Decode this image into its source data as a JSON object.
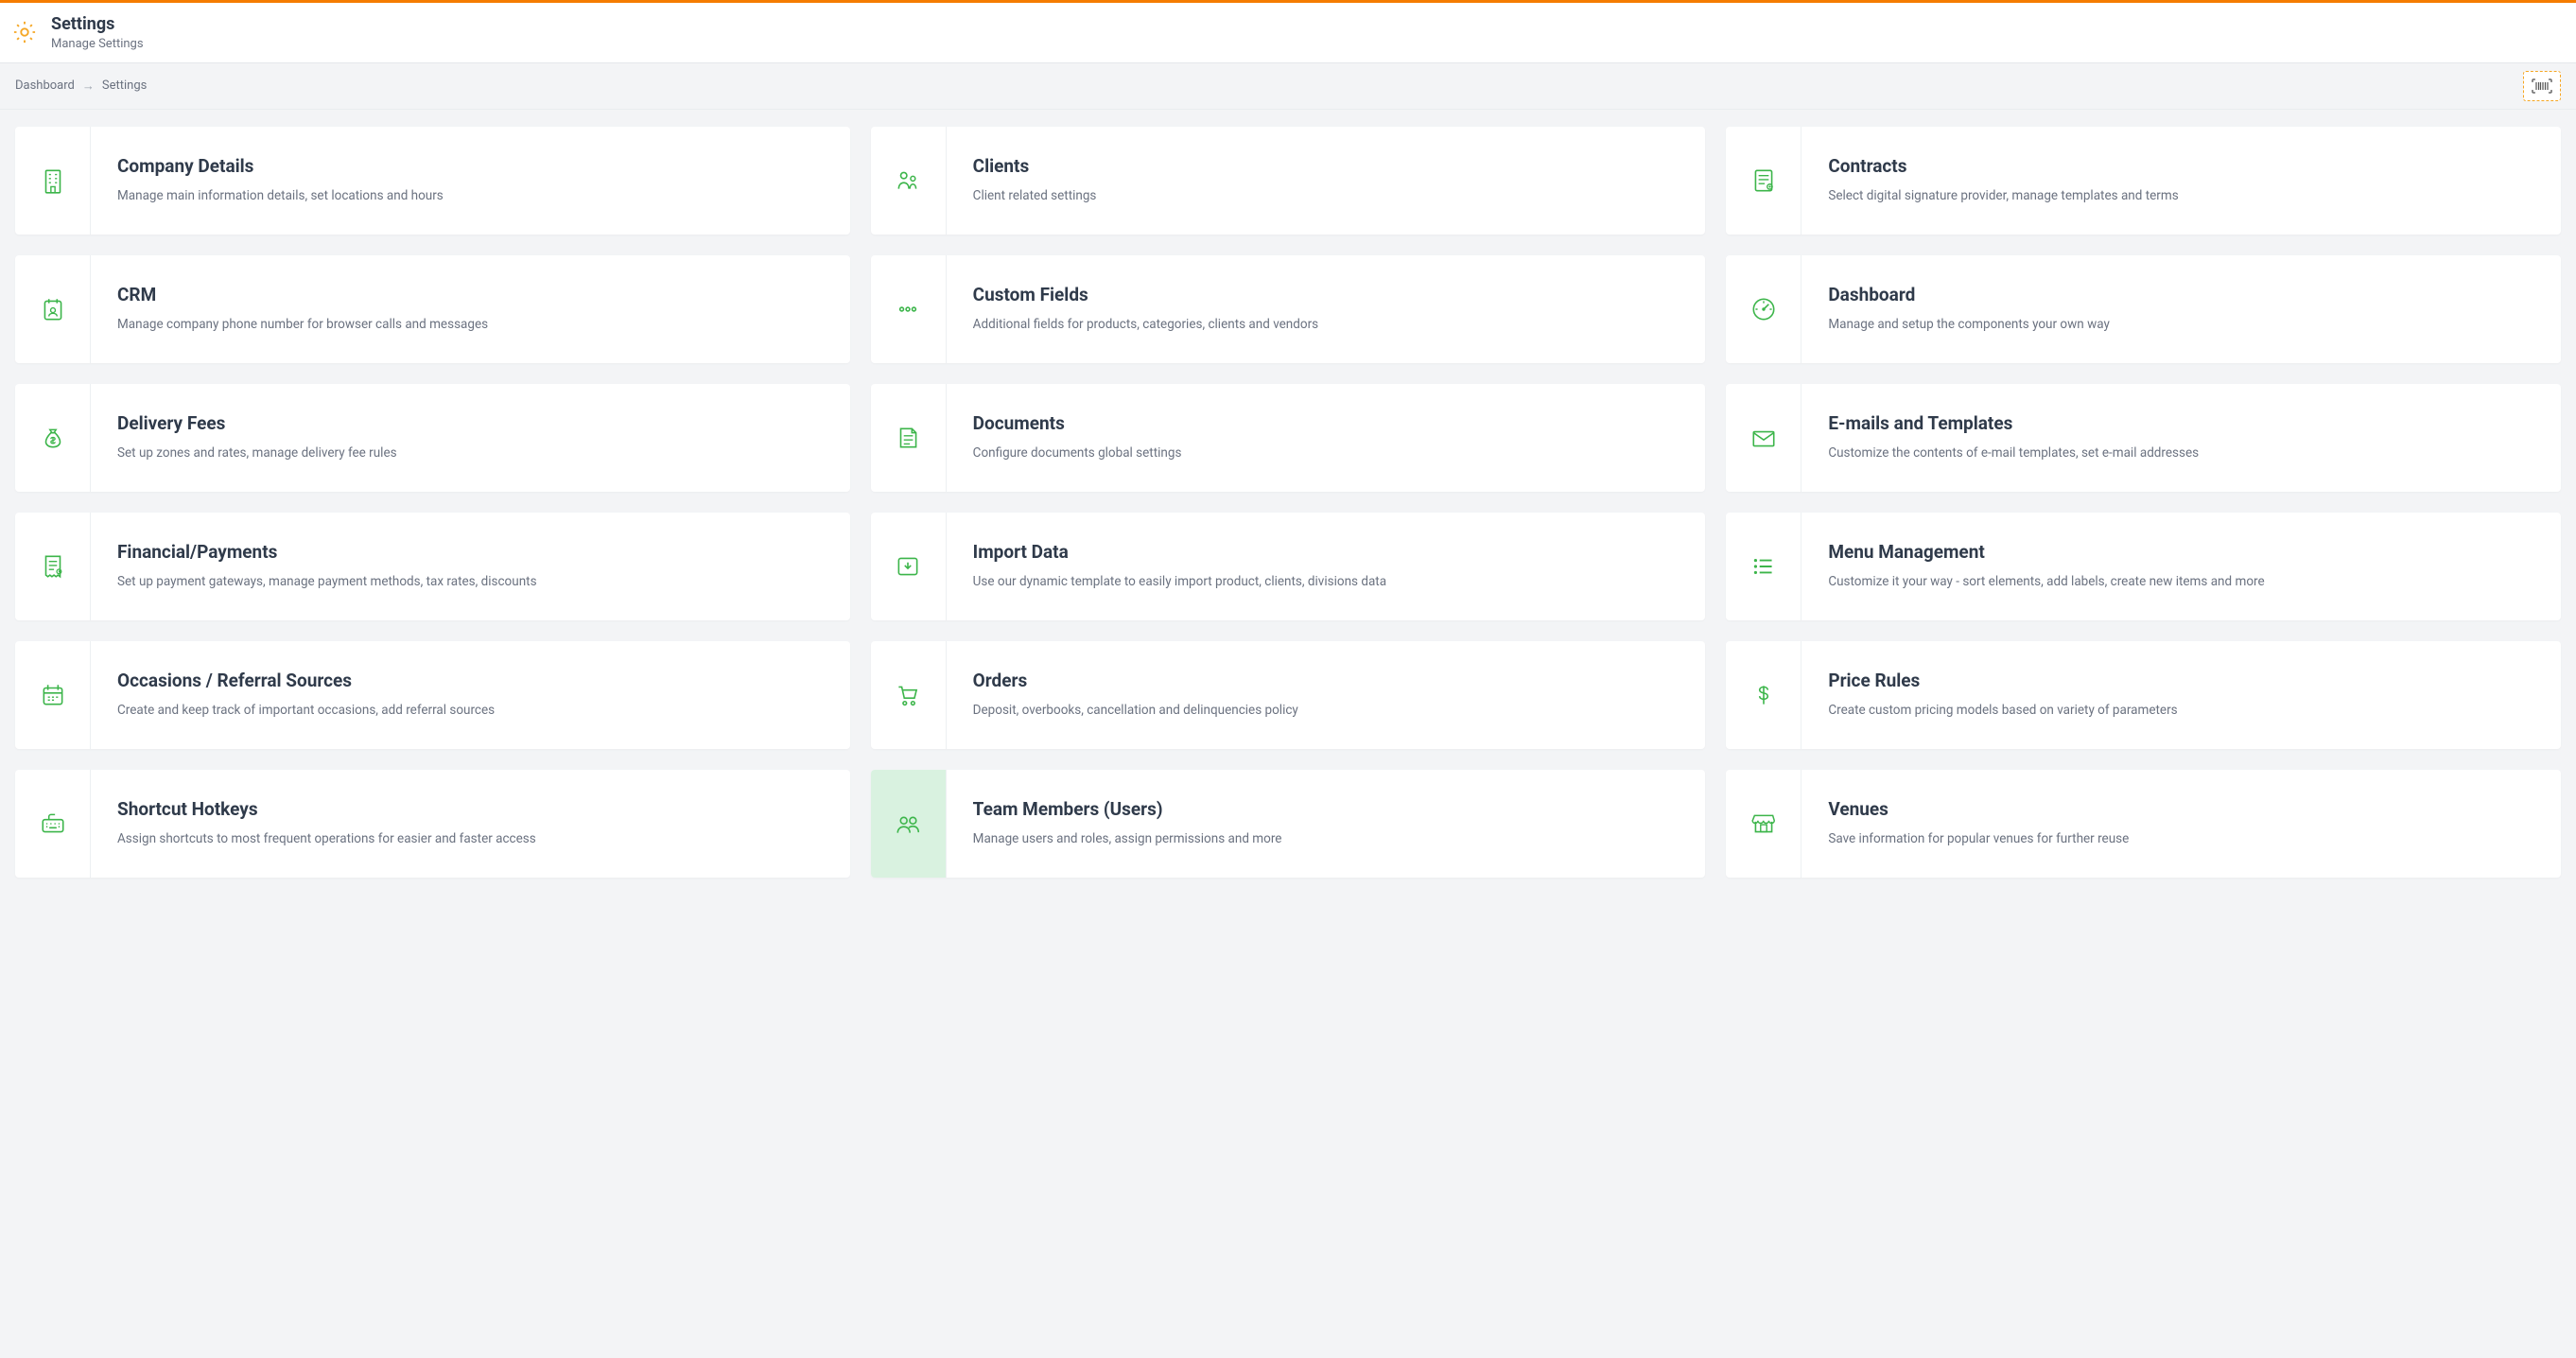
{
  "header": {
    "title": "Settings",
    "subtitle": "Manage Settings"
  },
  "breadcrumb": {
    "root": "Dashboard",
    "current": "Settings"
  },
  "cards": [
    {
      "icon": "building",
      "title": "Company Details",
      "desc": "Manage main information details, set locations and hours"
    },
    {
      "icon": "clients",
      "title": "Clients",
      "desc": "Client related settings"
    },
    {
      "icon": "contract",
      "title": "Contracts",
      "desc": "Select digital signature provider, manage templates and terms"
    },
    {
      "icon": "crm",
      "title": "CRM",
      "desc": "Manage company phone number for browser calls and messages"
    },
    {
      "icon": "dots",
      "title": "Custom Fields",
      "desc": "Additional fields for products, categories, clients and vendors"
    },
    {
      "icon": "gauge",
      "title": "Dashboard",
      "desc": "Manage and setup the components your own way"
    },
    {
      "icon": "moneybag",
      "title": "Delivery Fees",
      "desc": "Set up zones and rates, manage delivery fee rules"
    },
    {
      "icon": "document",
      "title": "Documents",
      "desc": "Configure documents global settings"
    },
    {
      "icon": "envelope",
      "title": "E-mails and Templates",
      "desc": "Customize the contents of e-mail templates, set e-mail addresses"
    },
    {
      "icon": "receipt",
      "title": "Financial/Payments",
      "desc": "Set up payment gateways, manage payment methods, tax rates, discounts"
    },
    {
      "icon": "import",
      "title": "Import Data",
      "desc": "Use our dynamic template to easily import product, clients, divisions data"
    },
    {
      "icon": "list",
      "title": "Menu Management",
      "desc": "Customize it your way - sort elements, add labels, create new items and more"
    },
    {
      "icon": "calendar",
      "title": "Occasions / Referral Sources",
      "desc": "Create and keep track of important occasions, add referral sources"
    },
    {
      "icon": "cart",
      "title": "Orders",
      "desc": "Deposit, overbooks, cancellation and delinquencies policy"
    },
    {
      "icon": "dollar",
      "title": "Price Rules",
      "desc": "Create custom pricing models based on variety of parameters"
    },
    {
      "icon": "keyboard",
      "title": "Shortcut Hotkeys",
      "desc": "Assign shortcuts to most frequent operations for easier and faster access"
    },
    {
      "icon": "users",
      "title": "Team Members (Users)",
      "desc": "Manage users and roles, assign permissions and more",
      "hover": true
    },
    {
      "icon": "store",
      "title": "Venues",
      "desc": "Save information for popular venues for further reuse"
    }
  ]
}
